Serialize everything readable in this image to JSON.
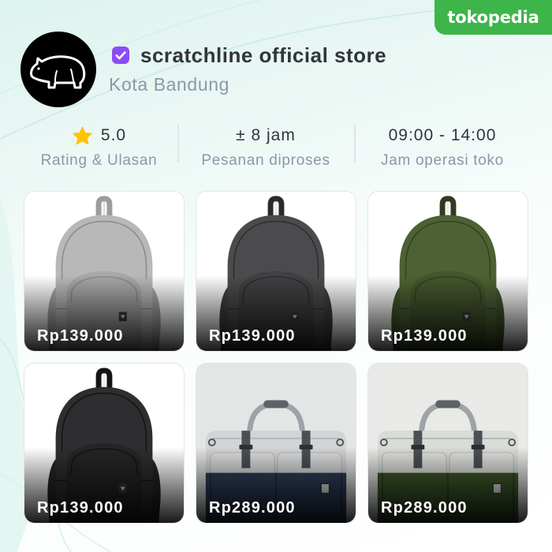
{
  "brand": {
    "logo_text": "tokopedia"
  },
  "store": {
    "name": "scratchline official store",
    "location": "Kota Bandung",
    "badge_icon": "official-store-badge-icon",
    "avatar_icon": "wombat-logo-icon"
  },
  "stats": [
    {
      "icon": "star-icon",
      "value": "5.0",
      "label": "Rating & Ulasan"
    },
    {
      "value": "± 8 jam",
      "label": "Pesanan diproses"
    },
    {
      "value": "09:00 - 14:00",
      "label": "Jam operasi toko"
    }
  ],
  "products": [
    {
      "price": "Rp139.000"
    },
    {
      "price": "Rp139.000"
    },
    {
      "price": "Rp139.000"
    },
    {
      "price": "Rp139.000"
    },
    {
      "price": "Rp289.000"
    },
    {
      "price": "Rp289.000"
    }
  ],
  "colors": {
    "accent": "#3DB54A",
    "badge": "#8B4CF7",
    "star": "#FFC400",
    "text_primary": "#31353B",
    "text_secondary": "#8D96AA"
  }
}
